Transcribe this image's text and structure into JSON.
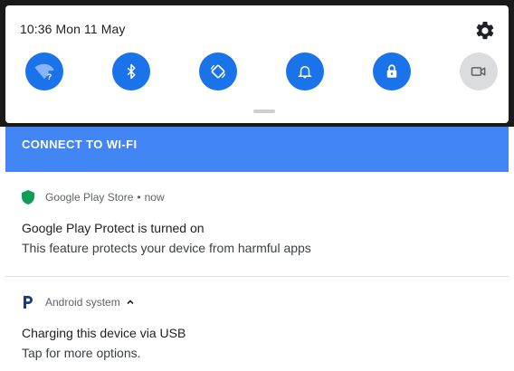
{
  "status": {
    "datetime": "10:36  Mon 11 May"
  },
  "quick_settings": {
    "tiles": [
      {
        "name": "wifi",
        "state": "on"
      },
      {
        "name": "bluetooth",
        "state": "on"
      },
      {
        "name": "auto-rotate",
        "state": "on"
      },
      {
        "name": "sound",
        "state": "on"
      },
      {
        "name": "lock",
        "state": "on"
      },
      {
        "name": "screen-record",
        "state": "off"
      }
    ],
    "icons": {
      "settings": "gear-icon",
      "wifi": "wifi-question-icon",
      "bluetooth": "bluetooth-icon",
      "rotate": "auto-rotate-icon",
      "sound": "bell-icon",
      "lock": "lock-icon",
      "record": "camera-icon"
    }
  },
  "connect_banner": {
    "label": "CONNECT TO WI-FI"
  },
  "notifications": [
    {
      "app": "Google Play Store",
      "time": "now",
      "title": "Google Play Protect is turned on",
      "text": "This feature protects your device from harmful apps"
    },
    {
      "app": "Android system",
      "title": "Charging this device via USB",
      "text": "Tap for more options."
    }
  ],
  "colors": {
    "accent": "#1a73e8",
    "banner": "#4285f4",
    "shield": "#0f9d58",
    "tile_off": "#dadce0"
  }
}
